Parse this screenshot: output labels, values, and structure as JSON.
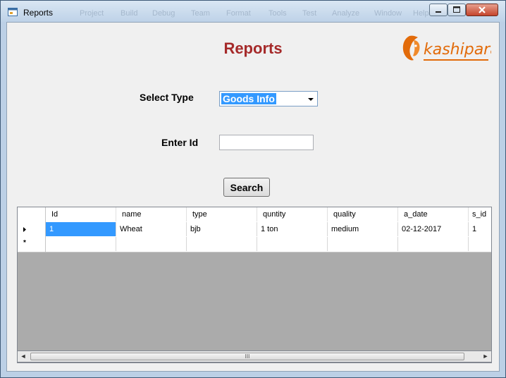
{
  "window": {
    "title": "Reports",
    "background_menu": [
      "Project",
      "Build",
      "Debug",
      "Team",
      "Format",
      "Tools",
      "Test",
      "Analyze",
      "Window",
      "Help"
    ]
  },
  "heading": "Reports",
  "logo": {
    "text": "kashipara",
    "icon": "lion-head-icon",
    "color": "#e26b0a"
  },
  "form": {
    "select_type_label": "Select Type",
    "select_type_value": "Goods Info",
    "enter_id_label": "Enter Id",
    "enter_id_value": "",
    "search_button": "Search"
  },
  "grid": {
    "columns": [
      "Id",
      "name",
      "type",
      "quntity",
      "quality",
      "a_date",
      "s_id"
    ],
    "rows": [
      [
        "1",
        "Wheat",
        "bjb",
        "1 ton",
        "medium",
        "02-12-2017",
        "1"
      ]
    ],
    "new_row_marker": "*",
    "scroll_grip": "III"
  },
  "colors": {
    "heading": "#a52a2a",
    "selection": "#3399ff",
    "grid_background": "#ababab"
  }
}
